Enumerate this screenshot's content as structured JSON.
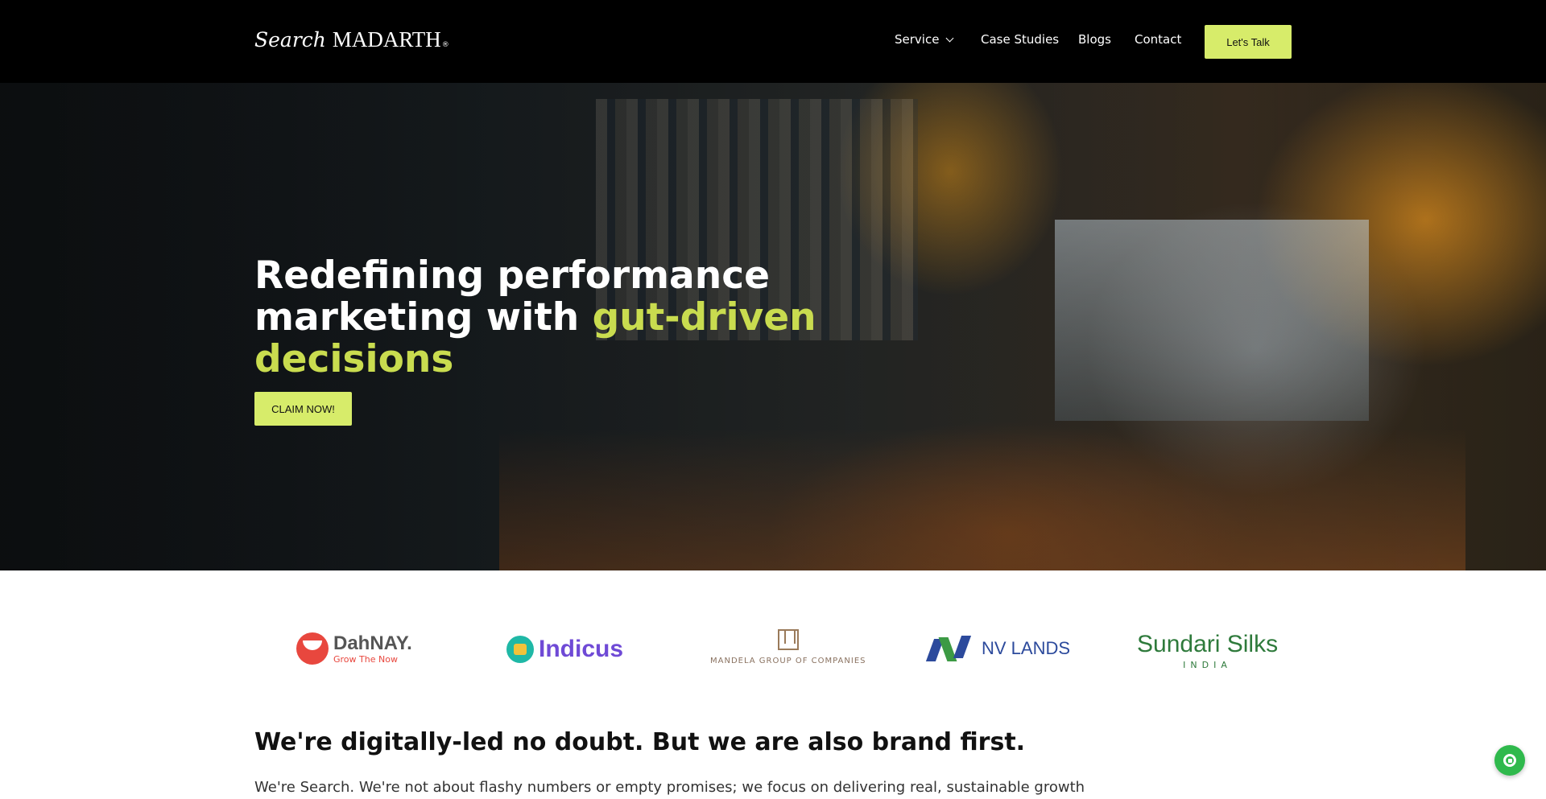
{
  "header": {
    "logo_script": "Search",
    "logo_brand": "MADARTH",
    "logo_reg": "®",
    "nav": [
      {
        "label": "Service",
        "has_dropdown": true
      },
      {
        "label": "Case Studies"
      },
      {
        "label": "Blogs"
      },
      {
        "label": "Contact"
      }
    ],
    "cta_label": "Let's Talk"
  },
  "hero": {
    "title_line1": "Redefining performance",
    "title_line2_prefix": "marketing with ",
    "title_highlight1": "gut-driven",
    "title_highlight2": "decisions",
    "button_label": "CLAIM NOW!"
  },
  "clients": [
    {
      "name": "DahNAY.",
      "tagline": "Grow The Now"
    },
    {
      "name": "Indicus"
    },
    {
      "name": "MANDELA GROUP OF COMPANIES"
    },
    {
      "name": "NV LANDS"
    },
    {
      "name": "Sundari Silks",
      "sub": "INDIA"
    }
  ],
  "intro": {
    "title": "We're digitally-led no doubt. But we are also brand first.",
    "body": "We're Search. We're not about flashy numbers or empty promises; we focus on delivering real, sustainable growth"
  },
  "colors": {
    "accent": "#d7ec6a",
    "highlight_text": "#c9dc4f",
    "header_bg": "#000000",
    "whatsapp": "#2fb94c"
  },
  "icons": {
    "service_dropdown": "chevron-down-icon",
    "floating_chat": "whatsapp-icon"
  }
}
